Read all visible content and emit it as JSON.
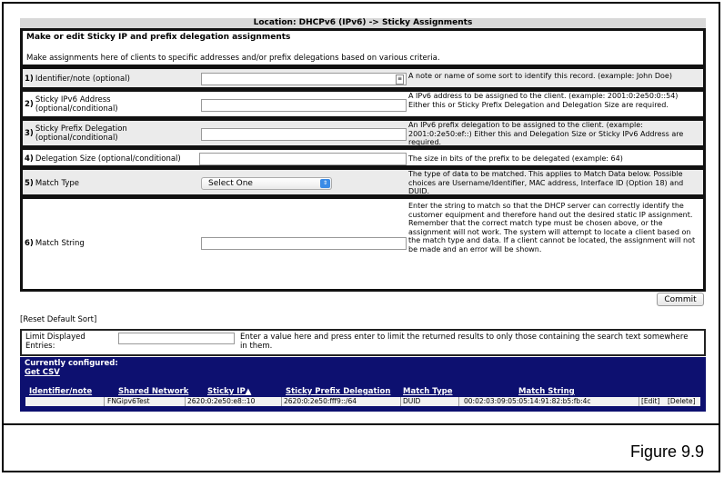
{
  "location_title": "Location: DHCPv6 (IPv6) -> Sticky Assignments",
  "section": {
    "heading": "Make or edit Sticky IP and prefix delegation assignments",
    "description": "Make assignments here of clients to specific addresses and/or prefix delegations based on various criteria."
  },
  "rows": [
    {
      "num": "1)",
      "label": "Identifier/note (optional)",
      "label2": "",
      "description": "A note or name of some sort to identify this record. (example: John Doe)"
    },
    {
      "num": "2)",
      "label": "Sticky IPv6 Address",
      "label2": "(optional/conditional)",
      "description": "A IPv6 address to be assigned to the client. (example: 2001:0:2e50:0::54) Either this or Sticky Prefix Delegation and Delegation Size are required."
    },
    {
      "num": "3)",
      "label": "Sticky Prefix Delegation",
      "label2": "(optional/conditional)",
      "description": "An IPv6 prefix delegation to be assigned to the client. (example: 2001:0:2e50:ef::) Either this and Delegation Size or Sticky IPv6 Address are required."
    },
    {
      "num": "4)",
      "label": "Delegation Size (optional/conditional)",
      "label2": "",
      "description": "The size in bits of the prefix to be delegated (example: 64)"
    },
    {
      "num": "5)",
      "label": "Match Type",
      "label2": "",
      "description": "The type of data to be matched. This applies to Match Data below. Possible choices are Username/Identifier, MAC address, Interface ID (Option 18) and DUID."
    },
    {
      "num": "6)",
      "label": "Match String",
      "label2": "",
      "description": "Enter the string to match so that the DHCP server can correctly identify the customer equipment and therefore hand out the desired static IP assignment. Remember that the correct match type must be chosen above, or the assignment will not work. The system will attempt to locate a client based on the match type and data. If a client cannot be located, the assignment will not be made and an error will be shown."
    }
  ],
  "match_type_select": "Select One",
  "commit_label": "Commit",
  "reset_sort_label": "[Reset Default Sort]",
  "limit": {
    "label": "Limit Displayed Entries:",
    "hint": "Enter a value here and press enter to limit the returned results to only those containing the search text somewhere in them."
  },
  "table": {
    "title": "Currently configured:",
    "csv_link": "Get CSV",
    "headers": [
      "Identifier/note",
      "Shared Network",
      "Sticky IP▲",
      "Sticky Prefix Delegation",
      "Match Type",
      "Match String"
    ],
    "row": {
      "identifier": "",
      "shared_network": "FNGipv6Test",
      "sticky_ip": "2620:0:2e50:e8::10",
      "prefix": "2620:0:2e50:fff9::/64",
      "match_type": "DUID",
      "match_string": "00:02:03:09:05:05:14:91:82:b5:fb:4c",
      "edit": "[Edit]",
      "delete": "[Delete]"
    },
    "header_bg": "#0d1070"
  },
  "figure_caption": "Figure 9.9"
}
